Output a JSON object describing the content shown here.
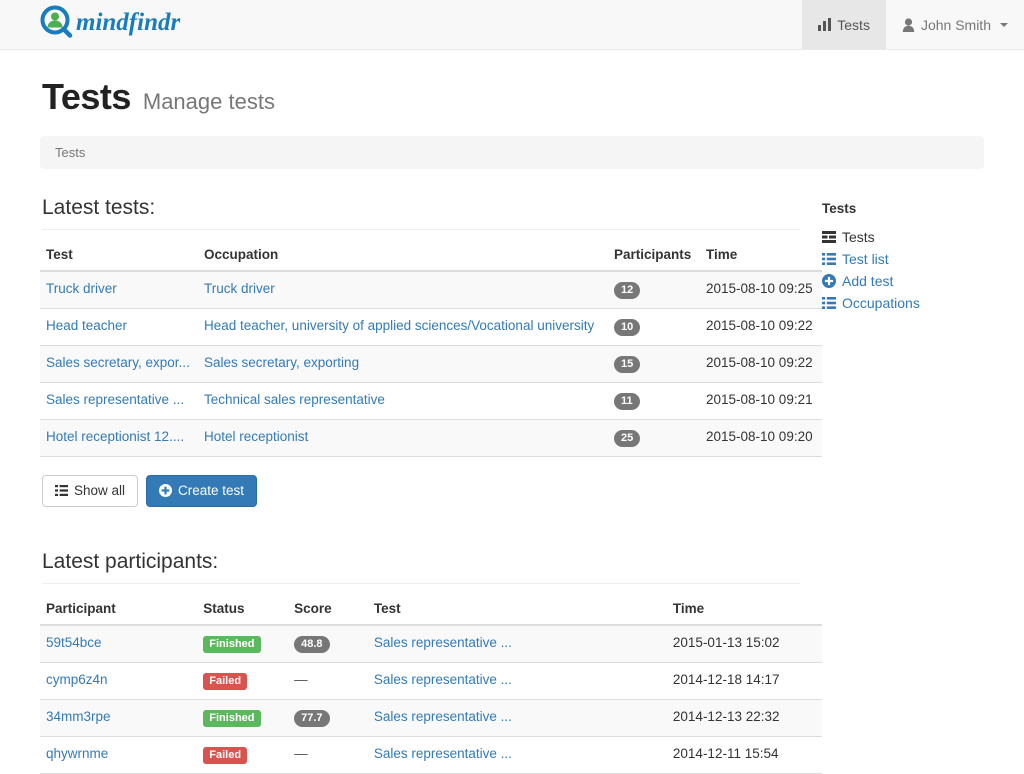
{
  "navbar": {
    "brand_text": "mindfindr",
    "brand_icon": "magnifier-person-logo",
    "items": [
      {
        "label": "Tests",
        "icon": "bar-chart-icon",
        "active": true
      },
      {
        "label": "John Smith",
        "icon": "user-icon",
        "active": false,
        "caret": true
      }
    ]
  },
  "header": {
    "title": "Tests",
    "subtitle": "Manage tests",
    "breadcrumb": "Tests"
  },
  "tests_section": {
    "heading": "Latest tests:",
    "columns": [
      "Test",
      "Occupation",
      "Participants",
      "Time"
    ],
    "rows": [
      {
        "test": "Truck driver",
        "occupation": "Truck driver",
        "participants": "12",
        "time": "2015-08-10 09:25"
      },
      {
        "test": "Head teacher",
        "occupation": "Head teacher, university of applied sciences/Vocational university",
        "participants": "10",
        "time": "2015-08-10 09:22"
      },
      {
        "test": "Sales secretary, expor...",
        "occupation": "Sales secretary, exporting",
        "participants": "15",
        "time": "2015-08-10 09:22"
      },
      {
        "test": "Sales representative ...",
        "occupation": "Technical sales representative",
        "participants": "11",
        "time": "2015-08-10 09:21"
      },
      {
        "test": "Hotel receptionist 12....",
        "occupation": "Hotel receptionist",
        "participants": "25",
        "time": "2015-08-10 09:20"
      }
    ],
    "buttons": {
      "show_all": {
        "label": "Show all",
        "icon": "list-icon"
      },
      "create_test": {
        "label": "Create test",
        "icon": "plus-circle-icon"
      }
    }
  },
  "participants_section": {
    "heading": "Latest participants:",
    "columns": [
      "Participant",
      "Status",
      "Score",
      "Test",
      "Time"
    ],
    "rows": [
      {
        "participant": "59t54bce",
        "status": "Finished",
        "status_type": "success",
        "score": "48.8",
        "test": "Sales representative ...",
        "time": "2015-01-13 15:02"
      },
      {
        "participant": "cymp6z4n",
        "status": "Failed",
        "status_type": "danger",
        "score": "—",
        "test": "Sales representative ...",
        "time": "2014-12-18 14:17"
      },
      {
        "participant": "34mm3rpe",
        "status": "Finished",
        "status_type": "success",
        "score": "77.7",
        "test": "Sales representative ...",
        "time": "2014-12-13 22:32"
      },
      {
        "participant": "qhywrnme",
        "status": "Failed",
        "status_type": "danger",
        "score": "—",
        "test": "Sales representative ...",
        "time": "2014-12-11 15:54"
      }
    ]
  },
  "sidebar": {
    "title": "Tests",
    "items": [
      {
        "label": "Tests",
        "icon": "th-list-icon",
        "current": true
      },
      {
        "label": "Test list",
        "icon": "list-icon",
        "current": false
      },
      {
        "label": "Add test",
        "icon": "plus-circle-icon",
        "current": false
      },
      {
        "label": "Occupations",
        "icon": "list-icon",
        "current": false
      }
    ]
  },
  "colors": {
    "brand_blue": "#1a7bbd",
    "brand_green": "#4cb050",
    "link": "#337ab7",
    "primary_button": "#337ab7",
    "badge_gray": "#777777",
    "success": "#5cb85c",
    "danger": "#d9534f",
    "navbar_bg": "#f8f8f8",
    "navbar_active_bg": "#e7e7e7",
    "breadcrumb_bg": "#f5f5f5",
    "stripe_bg": "#f9f9f9"
  }
}
